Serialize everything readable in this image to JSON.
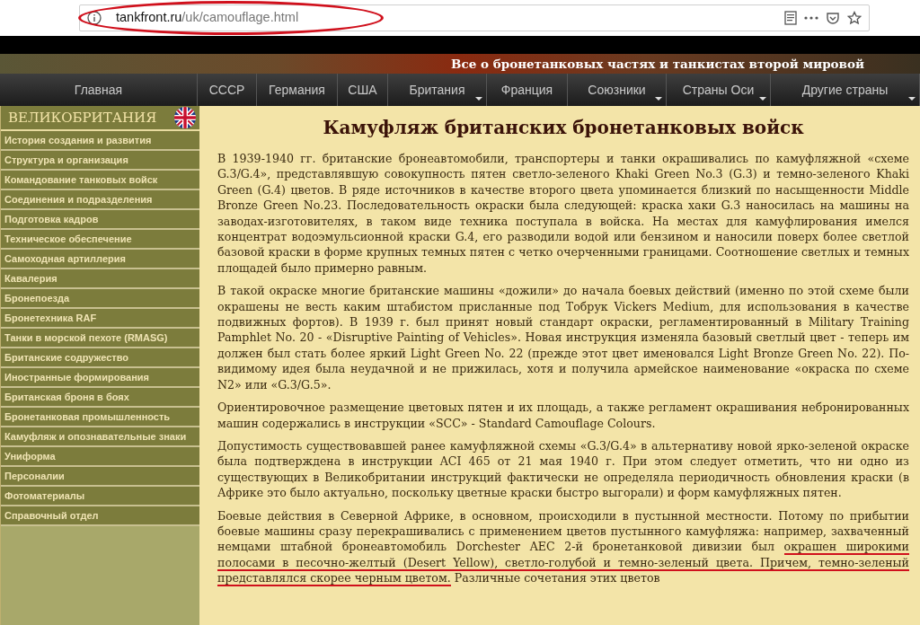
{
  "browser": {
    "url_domain": "tankfront.ru",
    "url_path": "/uk/camouflage.html"
  },
  "banner": {
    "tagline": "Все о бронетанковых частях и танкистах второй мировой"
  },
  "nav": [
    {
      "label": "Главная",
      "has_menu": false
    },
    {
      "label": "СССР",
      "has_menu": false
    },
    {
      "label": "Германия",
      "has_menu": false
    },
    {
      "label": "США",
      "has_menu": false
    },
    {
      "label": "Британия",
      "has_menu": true
    },
    {
      "label": "Франция",
      "has_menu": false
    },
    {
      "label": "Союзники",
      "has_menu": true
    },
    {
      "label": "Страны Оси",
      "has_menu": true
    },
    {
      "label": "Другие страны",
      "has_menu": true
    }
  ],
  "sidebar": {
    "title": "ВЕЛИКОБРИТАНИЯ",
    "items": [
      "История создания и развития",
      "Структура и организация",
      "Командование танковых войск",
      "Соединения и подразделения",
      "Подготовка кадров",
      "Техническое обеспечение",
      "Самоходная артиллерия",
      "Кавалерия",
      "Бронепоезда",
      "Бронетехника RAF",
      "Танки в морской пехоте (RMASG)",
      "Британские содружество",
      "Иностранные формирования",
      "Британская броня в боях",
      "Бронетанковая промышленность",
      "Камуфляж и опознавательные знаки",
      "Униформа",
      "Персоналии",
      "Фотоматериалы",
      "Справочный отдел"
    ]
  },
  "article": {
    "title": "Камуфляж британских бронетанковых войск",
    "paragraphs": [
      [
        {
          "text": "В 1939-1940 гг. британские бронеавтомобили, транспортеры и танки окрашивались по камуфляжной «схеме G.3/G.4», представлявшую совокупность пятен светло-зеленого Khaki Green No.3 (G.3) и темно-зеленого Khaki Green (G.4) цветов. В ряде источников в качестве второго цвета упоминается близкий по насыщенности Middle Bronze Green No.23. Последовательность окраски была следующей: краска хаки G.3 наносилась на машины на заводах-изготовителях, в таком виде техника поступала в войска. На местах для камуфлирования имелся концентрат водоэмульсионной краски G.4, его разводили водой или бензином и наносили поверх более светлой базовой краски в форме крупных темных пятен с четко очерченными границами. Соотношение светлых и темных площадей было примерно равным.",
          "underlined": false
        }
      ],
      [
        {
          "text": "В такой окраске многие британские машины «дожили» до начала боевых действий (именно по этой схеме были окрашены не весть каким штабистом присланные под Тобрук Vickers Medium, для использования в качестве подвижных фортов). В 1939 г. был принят новый стандарт окраски, регламентированный в Military Training Pamphlet No. 20 - «Disruptive Painting of Vehicles». Новая инструкция изменяла базовый светлый цвет - теперь им должен был стать более яркий Light Green No. 22 (прежде этот цвет именовался Light Bronze Green No. 22). По-видимому идея была неудачной и не прижилась, хотя и получила армейское наименование «окраска по схеме N2» или «G.3/G.5».",
          "underlined": false
        }
      ],
      [
        {
          "text": "Ориентировочное размещение цветовых пятен и их площадь, а также регламент окрашивания небронированных машин содержались в инструкции «SCC» - Standard Camouflage Colours.",
          "underlined": false
        }
      ],
      [
        {
          "text": "Допустимость существовавшей ранее камуфляжной схемы «G.3/G.4» в альтернативу новой ярко-зеленой окраске была подтверждена в инструкции ACI 465 от 21 мая 1940 г. При этом следует отметить, что ни одно из существующих в Великобритании инструкций фактически не определяла периодичность обновления краски (в Африке это было актуально, поскольку цветные краски быстро выгорали) и форм камуфляжных пятен.",
          "underlined": false
        }
      ],
      [
        {
          "text": "Боевые действия в Северной Африке, в основном, происходили в пустынной местности. Потому по прибытии боевые машины сразу перекрашивались с применением цветов пустынного камуфляжа: например, захваченный немцами штабной бронеавтомобиль Dorchester AEC 2-й бронетанковой дивизии был ",
          "underlined": false
        },
        {
          "text": "окрашен широкими полосами в песочно-желтый (Desert Yellow), светло-голубой и темно-зеленый цвета. Причем, темно-зеленый представлялся скорее черным цветом.",
          "underlined": true
        },
        {
          "text": " Различные сочетания этих цветов",
          "underlined": false
        }
      ]
    ]
  }
}
